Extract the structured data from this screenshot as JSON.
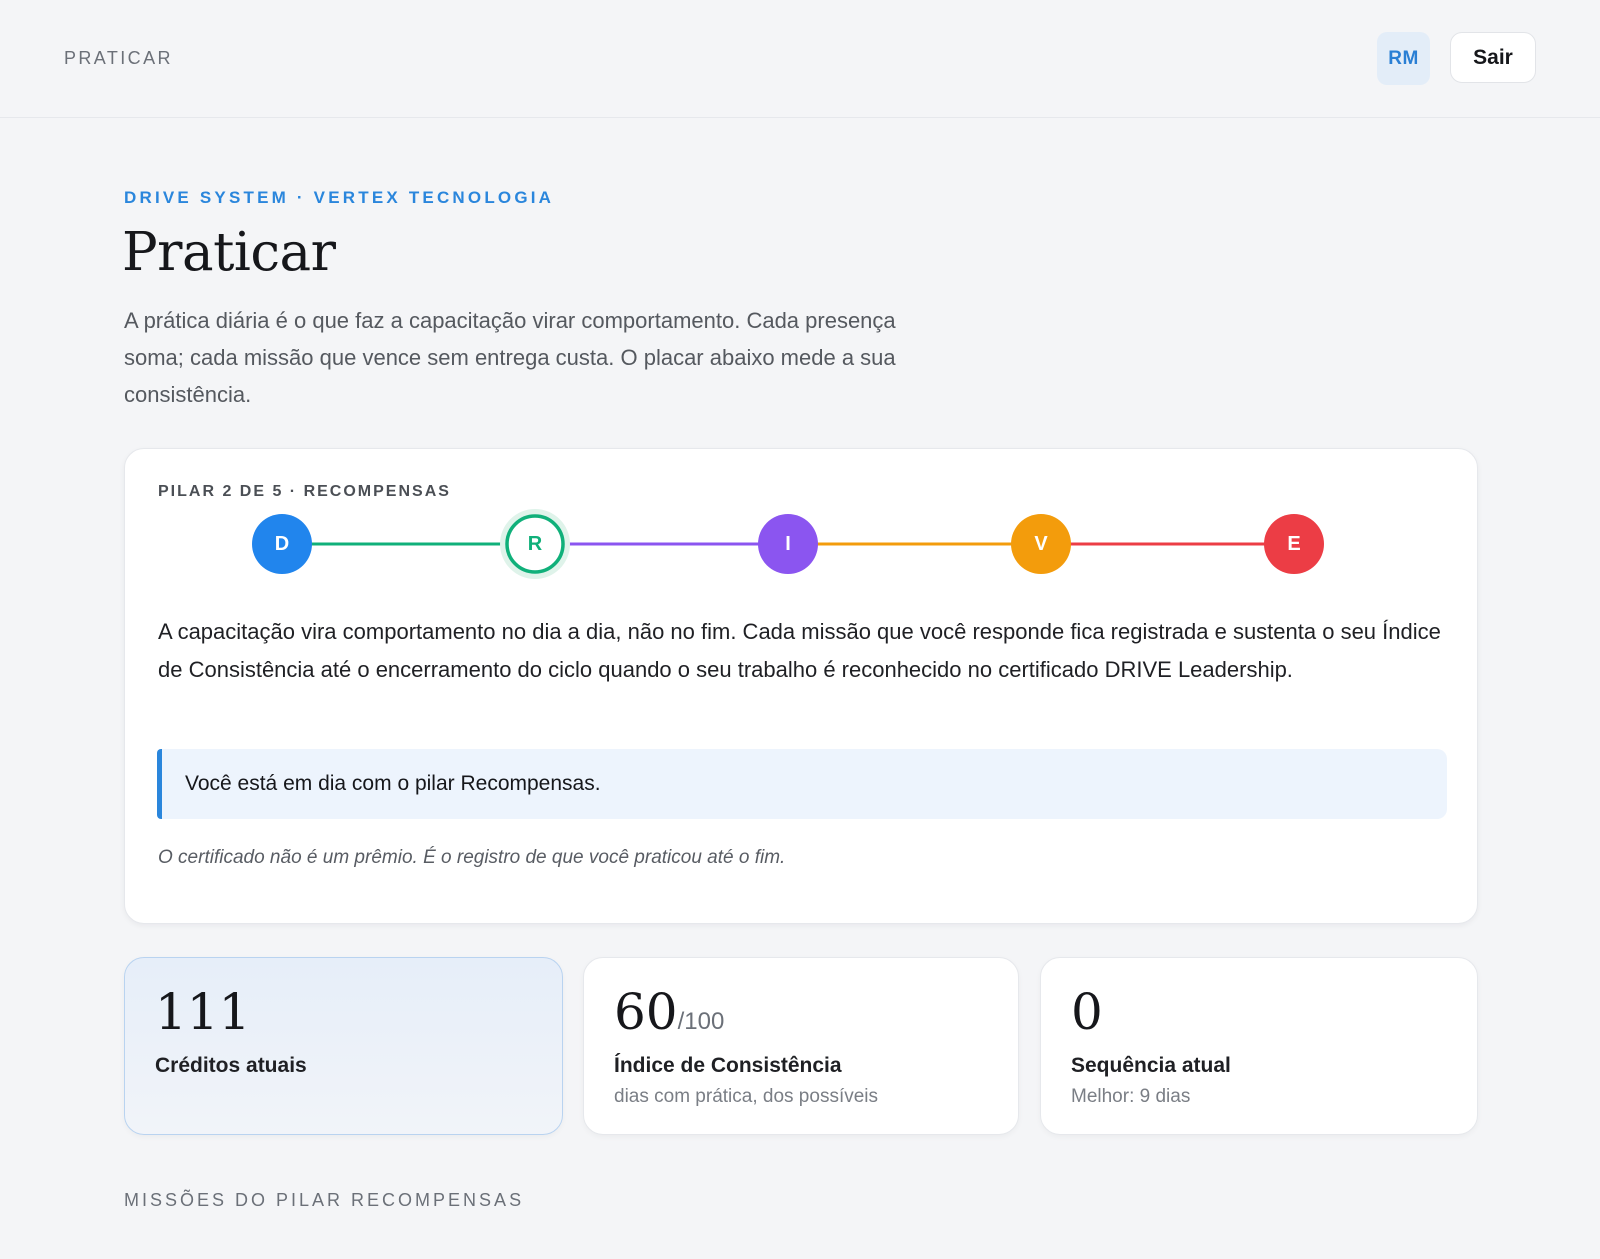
{
  "topbar": {
    "title": "PRATICAR",
    "avatar_initials": "RM",
    "logout_label": "Sair"
  },
  "header": {
    "eyebrow": "DRIVE SYSTEM · VERTEX TECNOLOGIA",
    "title": "Praticar",
    "intro": "A prática diária é o que faz a capacitação virar comportamento. Cada presença soma; cada missão que vence sem entrega custa. O placar abaixo mede a sua consistência."
  },
  "pillar_card": {
    "label": "PILAR 2 DE 5 · RECOMPENSAS",
    "current_step": 2,
    "steps": [
      {
        "letter": "D",
        "color": "#2185ed"
      },
      {
        "letter": "R",
        "color": "#10b07a"
      },
      {
        "letter": "I",
        "color": "#8b55f0"
      },
      {
        "letter": "V",
        "color": "#f39c0c"
      },
      {
        "letter": "E",
        "color": "#ec3d45"
      }
    ],
    "text": "A capacitação vira comportamento no dia a dia, não no fim. Cada missão que você responde fica registrada e sustenta o seu Índice de Consistência até o encerramento do ciclo quando o seu trabalho é reconhecido no certificado DRIVE Leadership.",
    "callout": "Você está em dia com o pilar Recompensas.",
    "quote": "O certificado não é um prêmio. É o registro de que você praticou até o fim."
  },
  "stats": [
    {
      "value": "111",
      "suffix": "",
      "label": "Créditos atuais",
      "sub": ""
    },
    {
      "value": "60",
      "suffix": "/100",
      "label": "Índice de Consistência",
      "sub": "dias com prática, dos possíveis"
    },
    {
      "value": "0",
      "suffix": "",
      "label": "Sequência atual",
      "sub": "Melhor: 9 dias"
    }
  ],
  "missions_section_label": "MISSÕES DO PILAR RECOMPENSAS"
}
